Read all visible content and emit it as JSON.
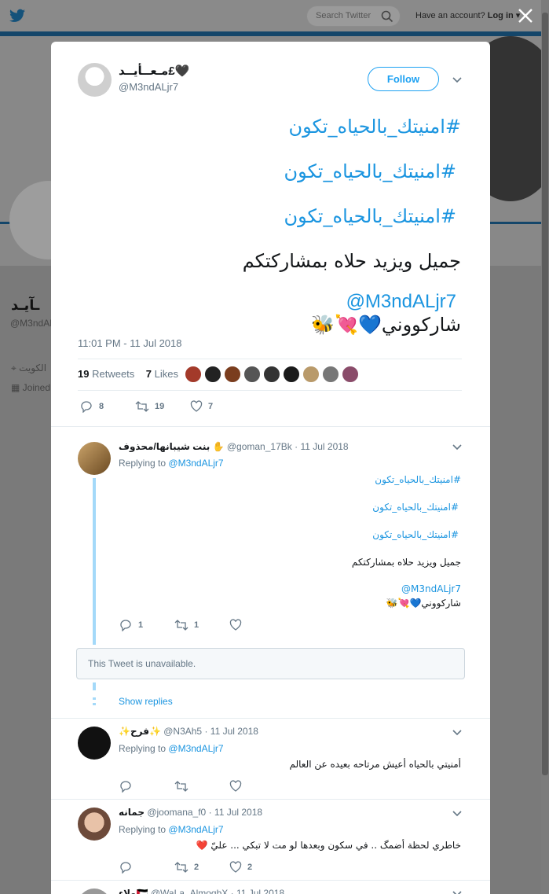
{
  "nav": {
    "search_placeholder": "Search Twitter",
    "account_prompt": "Have an account?",
    "login_label": "Log in"
  },
  "background_profile": {
    "name": "ـآيـد",
    "handle": "@M3ndAL",
    "location": "الكويت",
    "joined": "Joined"
  },
  "tweet": {
    "author_name": "مـعــأيــد£🖤",
    "author_handle": "@M3ndALjr7",
    "follow_label": "Follow",
    "lines": [
      {
        "text": "#امنيتك_بالحياه_تكون",
        "kind": "hash"
      },
      {
        "text": "#امنيتك_بالحياه_تكون",
        "kind": "hash"
      },
      {
        "text": "#امنيتك_بالحياه_تكون",
        "kind": "hash"
      },
      {
        "text": "جميل ويزيد حلاه بمشاركتكم",
        "kind": "plain"
      }
    ],
    "mention": "@M3ndALjr7",
    "share_line": "شاركووني💙💘🐝",
    "timestamp": "11:01 PM - 11 Jul 2018",
    "retweets_count": "19",
    "retweets_label": "Retweets",
    "likes_count": "7",
    "likes_label": "Likes",
    "reply_count": "8",
    "retweet_count": "19",
    "like_count": "7"
  },
  "replies": [
    {
      "name": "بنت شيبانها/محذوف ✋",
      "handle": "@goman_17Bk",
      "date": "· 11 Jul 2018",
      "replying_label": "Replying to",
      "replying_to": "@M3ndALjr7",
      "lines": [
        "#امنيتك_بالحياه_تكون",
        "#امنيتك_بالحياه_تكون",
        "#امنيتك_بالحياه_تكون",
        "جميل ويزيد حلاه بمشاركتكم"
      ],
      "mention": "@M3ndALjr7",
      "share_line": "شاركووني💙💘🐝",
      "reply_count": "1",
      "retweet_count": "1",
      "like_count": ""
    },
    {
      "name": "✨فرح✨",
      "handle": "@N3Ah5",
      "date": "· 11 Jul 2018",
      "replying_label": "Replying to",
      "replying_to": "@M3ndALjr7",
      "text": "أمنيتي بالحياه أعيش مرتاحه بعيده عن العالم",
      "reply_count": "",
      "retweet_count": "",
      "like_count": ""
    },
    {
      "name": "جمانه",
      "handle": "@joomana_f0",
      "date": "· 11 Jul 2018",
      "replying_label": "Replying to",
      "replying_to": "@M3ndALjr7",
      "text": "خاطري لحظة أضمگ .. في سكون وبعدها لو مت لا تبكي ... عليّ ❤️",
      "reply_count": "",
      "retweet_count": "2",
      "like_count": "2"
    },
    {
      "name": "ولاء🇵🇸",
      "handle": "@WaLa_AlmoqbX",
      "date": "· 11 Jul 2018"
    }
  ],
  "unavailable_text": "This Tweet is unavailable.",
  "show_replies_label": "Show replies",
  "colors": {
    "accent": "#1da1f2",
    "link": "#1b95e0",
    "muted": "#657786"
  }
}
